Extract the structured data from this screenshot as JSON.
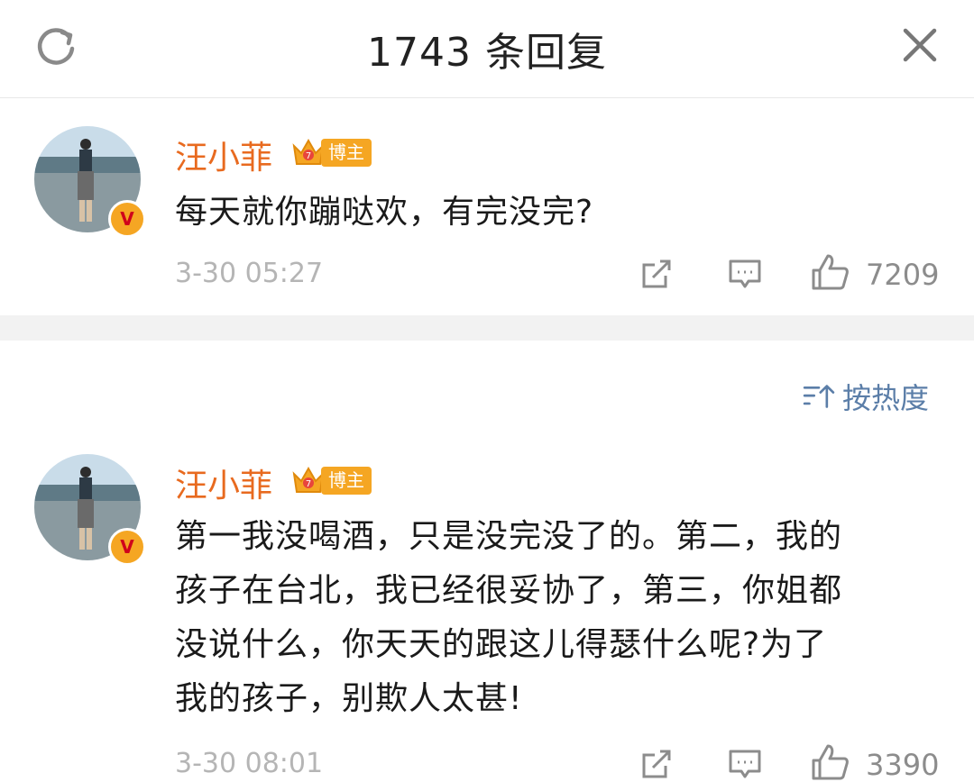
{
  "header": {
    "title": "1743 条回复"
  },
  "comments": [
    {
      "author": "汪小菲",
      "badge": "博主",
      "text": "每天就你蹦哒欢，有完没完?",
      "time": "3-30 05:27",
      "likes": "7209"
    },
    {
      "author": "汪小菲",
      "badge": "博主",
      "text_lines": [
        "第一我没喝酒，只是没完没了的。第二，我的",
        "孩子在台北，我已经很妥协了，第三，你姐都",
        "没说什么，你天天的跟这儿得瑟什么呢?为了",
        "我的孩子，别欺人太甚!"
      ],
      "time": "3-30 08:01",
      "likes": "3390"
    }
  ],
  "sort": {
    "label": "按热度"
  },
  "colors": {
    "name": "#e86a1f",
    "badge": "#f5a623",
    "sort": "#5b7ea8",
    "meta": "#b5b5b5"
  }
}
